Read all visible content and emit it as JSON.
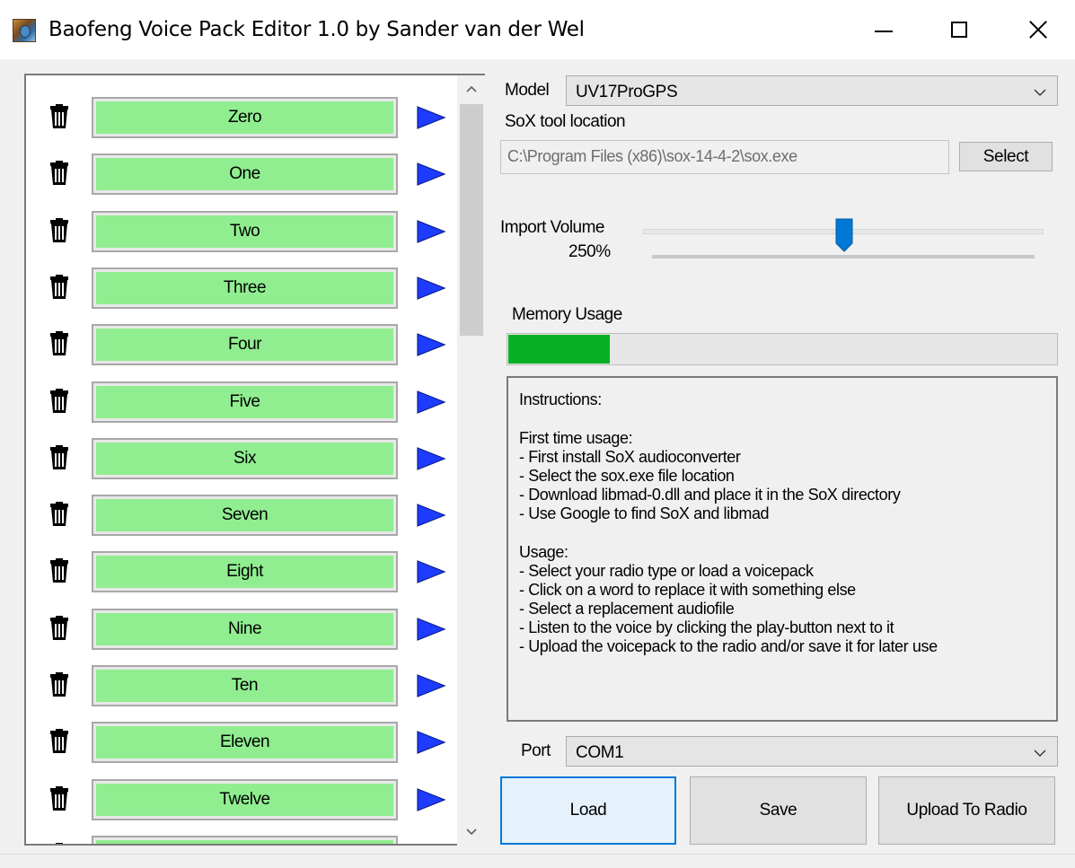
{
  "window": {
    "title": "Baofeng Voice Pack Editor 1.0 by Sander van der Wel",
    "controls": [
      "minimize-icon",
      "maximize-icon",
      "close-icon"
    ]
  },
  "word_list": {
    "items": [
      "Zero",
      "One",
      "Two",
      "Three",
      "Four",
      "Five",
      "Six",
      "Seven",
      "Eight",
      "Nine",
      "Ten",
      "Eleven",
      "Twelve",
      ""
    ],
    "row_icons": {
      "delete": "trash-icon",
      "play": "play-icon"
    },
    "colors": {
      "word_button": "#90ee90",
      "play_arrow": "#1e3cff"
    }
  },
  "model": {
    "label": "Model",
    "selected": "UV17ProGPS"
  },
  "sox": {
    "label": "SoX tool location",
    "path": "C:\\Program Files (x86)\\sox-14-4-2\\sox.exe",
    "select_label": "Select"
  },
  "import_volume": {
    "label": "Import Volume",
    "value_text": "250%",
    "slider_fraction": 0.5
  },
  "memory_usage": {
    "label": "Memory Usage",
    "fraction": 0.185,
    "color": "#06b025"
  },
  "instructions": {
    "lines": [
      "Instructions:",
      "",
      "First time usage:",
      "- First install SoX audioconverter",
      "- Select the sox.exe file location",
      "- Download libmad-0.dll and place it in the SoX directory",
      "- Use Google to find SoX and libmad",
      "",
      "Usage:",
      "- Select your radio type or load a voicepack",
      "- Click on a word to replace it with something else",
      "- Select a replacement audiofile",
      "- Listen to the voice by clicking the play-button next to it",
      "- Upload the voicepack to the radio and/or save it for later use"
    ]
  },
  "port": {
    "label": "Port",
    "selected": "COM1"
  },
  "actions": {
    "load": "Load",
    "save": "Save",
    "upload": "Upload To Radio"
  }
}
